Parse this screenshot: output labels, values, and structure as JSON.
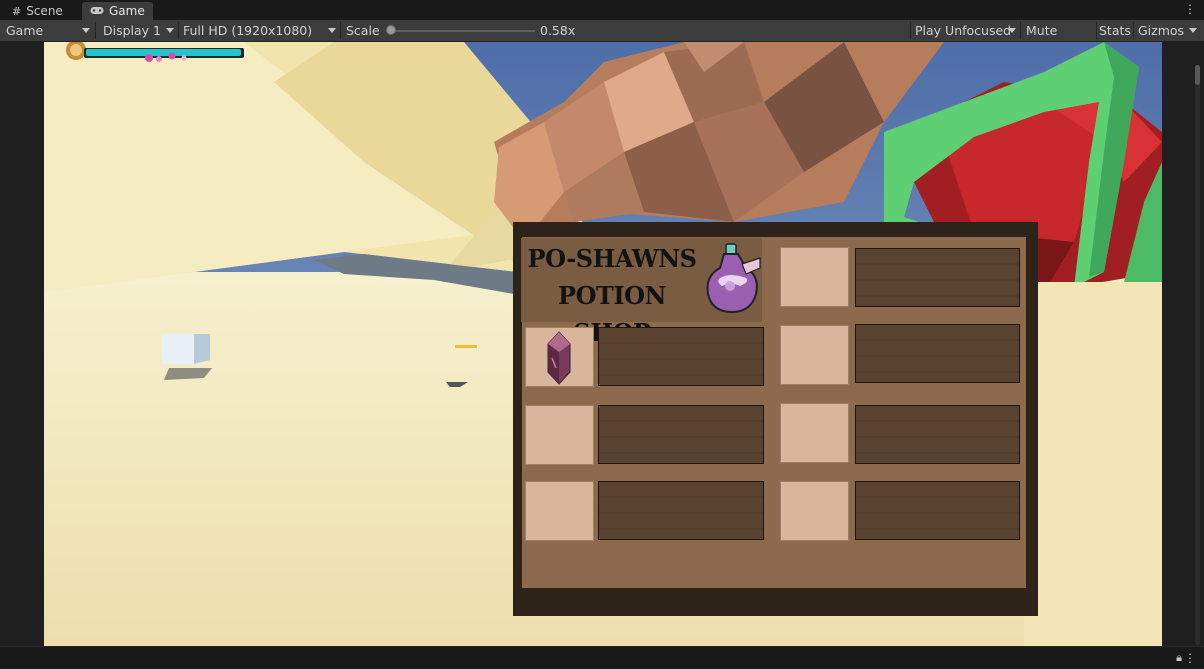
{
  "tabs": [
    {
      "label": "Scene",
      "icon": "grid-icon"
    },
    {
      "label": "Game",
      "icon": "gamepad-icon"
    }
  ],
  "toolbar": {
    "mode": "Game",
    "display": "Display 1",
    "resolution": "Full HD (1920x1080)",
    "scale_label": "Scale",
    "scale_value": "0.58x",
    "scale_fraction": 0.0,
    "play_focus": "Play Unfocused",
    "mute": "Mute Audio",
    "stats": "Stats",
    "gizmos": "Gizmos"
  },
  "shop": {
    "title_line1": "PO-SHAWNS",
    "title_line2": "POTION SHOP",
    "left_slots": [
      "crystal",
      "empty",
      "empty"
    ],
    "right_slots": [
      "empty",
      "empty",
      "empty",
      "empty"
    ]
  },
  "colors": {
    "sky": "#5b7ab0",
    "sand": "#f3e6b4",
    "panel_dark": "#2e2318",
    "panel_wood": "#8c6a4e",
    "slot": "#d8b59d",
    "plank": "#5a4230",
    "health_bar": "#23c3d0"
  }
}
